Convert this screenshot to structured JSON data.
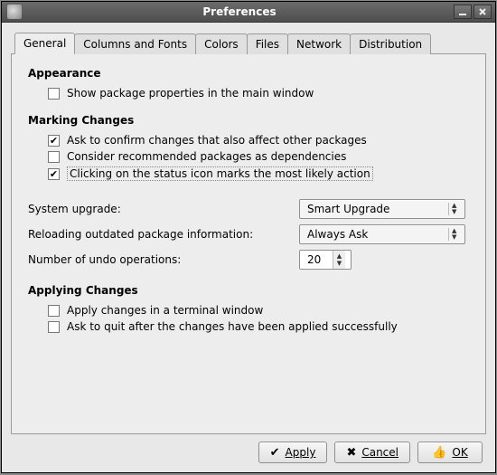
{
  "window": {
    "title": "Preferences"
  },
  "tabs": [
    "General",
    "Columns and Fonts",
    "Colors",
    "Files",
    "Network",
    "Distribution"
  ],
  "general": {
    "appearance": {
      "heading": "Appearance",
      "show_props": {
        "label": "Show package properties in the main window",
        "checked": false
      }
    },
    "marking": {
      "heading": "Marking Changes",
      "confirm_affect": {
        "label": "Ask to confirm changes that also affect other packages",
        "checked": true
      },
      "recommended_deps": {
        "label": "Consider recommended packages as dependencies",
        "checked": false
      },
      "status_icon_action": {
        "label": "Clicking on the status icon marks the most likely action",
        "checked": true
      },
      "system_upgrade": {
        "label": "System upgrade:",
        "value": "Smart Upgrade"
      },
      "reload_info": {
        "label": "Reloading outdated package information:",
        "value": "Always Ask"
      },
      "undo_ops": {
        "label": "Number of undo operations:",
        "value": "20"
      }
    },
    "applying": {
      "heading": "Applying Changes",
      "terminal": {
        "label": "Apply changes in a terminal window",
        "checked": false
      },
      "ask_quit": {
        "label": "Ask to quit after the changes have been applied successfully",
        "checked": false
      }
    }
  },
  "buttons": {
    "apply": "Apply",
    "cancel": "Cancel",
    "ok": "OK"
  }
}
